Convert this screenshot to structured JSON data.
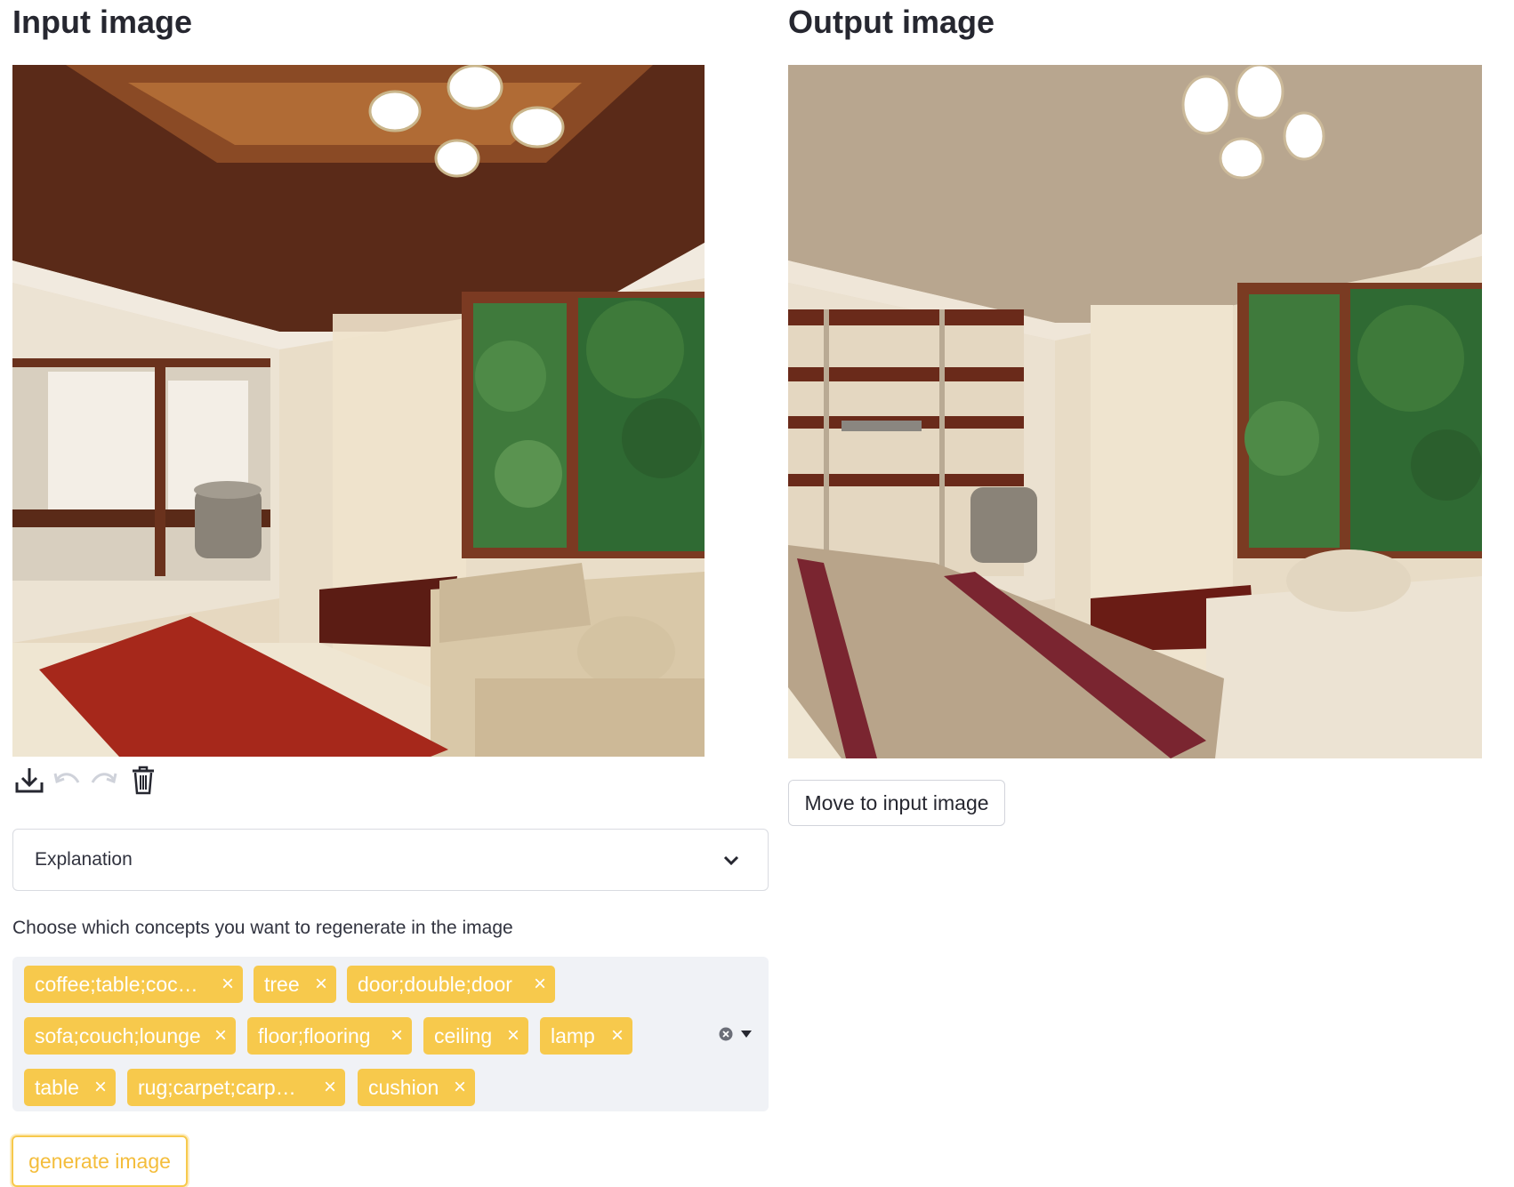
{
  "input_section": {
    "title": "Input image",
    "toolbar": {
      "download_icon": "download-icon",
      "undo_icon": "undo-icon",
      "redo_icon": "redo-icon",
      "delete_icon": "trash-icon"
    }
  },
  "output_section": {
    "title": "Output image",
    "move_button_label": "Move to input image"
  },
  "explanation": {
    "label": "Explanation",
    "icon": "chevron-down-icon"
  },
  "concepts": {
    "label": "Choose which concepts you want to regenerate in the image",
    "tags": [
      "coffee;table;coc…",
      "tree",
      "door;double;door",
      "sofa;couch;lounge",
      "floor;flooring",
      "ceiling",
      "lamp",
      "table",
      "rug;carpet;carpe…",
      "cushion"
    ],
    "remove_symbol": "×",
    "clear_icon": "clear-all-icon",
    "dropdown_icon": "caret-down-icon"
  },
  "generate_button_label": "generate image",
  "colors": {
    "tag_bg": "#f7c94c",
    "accent": "#f4bd3b",
    "text": "#31333f",
    "multiselect_bg": "#f0f2f6"
  }
}
